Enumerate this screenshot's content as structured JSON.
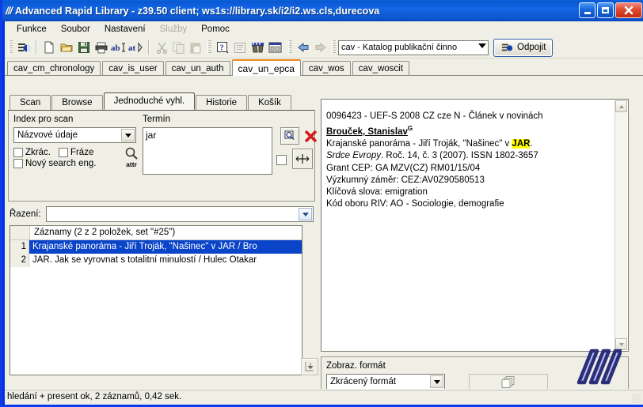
{
  "window": {
    "title": "Advanced Rapid Library - z39.50 client; ws1s://library.sk/i2/i2.ws.cls,durecova",
    "logo_slashes": "///",
    "minimize_label": "_",
    "maximize_label": "□",
    "close_label": "✕"
  },
  "menu": {
    "items": [
      {
        "label": "Funkce",
        "disabled": false
      },
      {
        "label": "Soubor",
        "disabled": false
      },
      {
        "label": "Nastavení",
        "disabled": false
      },
      {
        "label": "Služby",
        "disabled": true
      },
      {
        "label": "Pomoc",
        "disabled": false
      }
    ]
  },
  "toolbar": {
    "icons": [
      "connect-icon",
      "new-document-icon",
      "open-folder-icon",
      "save-disk-icon",
      "print-icon",
      "abi-icon",
      "at-icon",
      "cut-icon",
      "copy-icon",
      "paste-icon",
      "help-icon",
      "record-icon",
      "binoculars-icon",
      "window-icon"
    ],
    "nav_back": "back-arrow-icon",
    "nav_forward": "forward-arrow-icon",
    "database_combo": "cav - Katalog publikační činno",
    "disconnect_label": "Odpojit"
  },
  "db_tabs": [
    {
      "label": "cav_cm_chronology",
      "active": false
    },
    {
      "label": "cav_is_user",
      "active": false
    },
    {
      "label": "cav_un_auth",
      "active": false
    },
    {
      "label": "cav_un_epca",
      "active": true
    },
    {
      "label": "cav_wos",
      "active": false
    },
    {
      "label": "cav_woscit",
      "active": false
    }
  ],
  "search": {
    "tabs": [
      {
        "label": "Scan",
        "active": false
      },
      {
        "label": "Browse",
        "active": false
      },
      {
        "label": "Jednoduché vyhl.",
        "active": true
      },
      {
        "label": "Historie",
        "active": false
      },
      {
        "label": "Košík",
        "active": false
      }
    ],
    "index_label": "Index pro scan",
    "index_value": "Názvové údaje",
    "term_label": "Termín",
    "term_value": "jar",
    "checkboxes": [
      {
        "label": "Zkrác.",
        "checked": false
      },
      {
        "label": "Fráze",
        "checked": false
      },
      {
        "label": "Nový search eng.",
        "checked": false
      }
    ],
    "attr_label": "attr",
    "search_button": "search-icon",
    "clear_button": "clear-red-x-icon",
    "extra_checkbox": false,
    "resize_button": "horizontal-resize-icon"
  },
  "sorting": {
    "label": "Řazení:",
    "value": ""
  },
  "results": {
    "header": "Záznamy (2 z 2 položek, set \"#25\")",
    "rows": [
      {
        "num": "1",
        "text": "Krajanské panoráma - Jiří Troják, \"Našinec\" v JAR / Bro",
        "selected": true
      },
      {
        "num": "2",
        "text": "JAR. Jak se vyrovnat s totalitní minulostí / Hulec Otakar",
        "selected": false
      }
    ],
    "save_button": "save-down-arrow-icon"
  },
  "record": {
    "line1": "0096423 - UEF-S 2008 CZ cze N - Článek v novinách",
    "author": "Brouček, Stanislav",
    "author_sup": "G",
    "title_pre": "Krajanské panoráma - Jiří Troják, \"Našinec\" v ",
    "title_highlight": "JAR",
    "title_post": ".",
    "source_italic": "Srdce Evropy",
    "source_rest": ". Roč. 14, č. 3 (2007). ISSN 1802-3657",
    "grant": "Grant CEP: GA MZV(CZ) RM01/15/04",
    "research": "Výzkumný záměr: CEZ:AV0Z90580513",
    "keywords": "Klíčová slova: emigration",
    "riv": "Kód oboru RIV: AO - Sociologie, demografie"
  },
  "format": {
    "label": "Zobraz. formát",
    "value": "Zkrácený formát",
    "copy_button": "copy-records-icon",
    "brand_logo": "arl-slashes-logo"
  },
  "status": {
    "text": "hledání + present ok, 2 záznamů, 0,42 sek."
  },
  "colors": {
    "title_blue": "#0d55cf",
    "window_border": "#0b3ce8",
    "panel_bg": "#f0efe6",
    "selection_blue": "#0a44c8",
    "accent_orange": "#e98b1a",
    "highlight_yellow": "#ffff00",
    "brand_navy": "#2b2f7a"
  }
}
